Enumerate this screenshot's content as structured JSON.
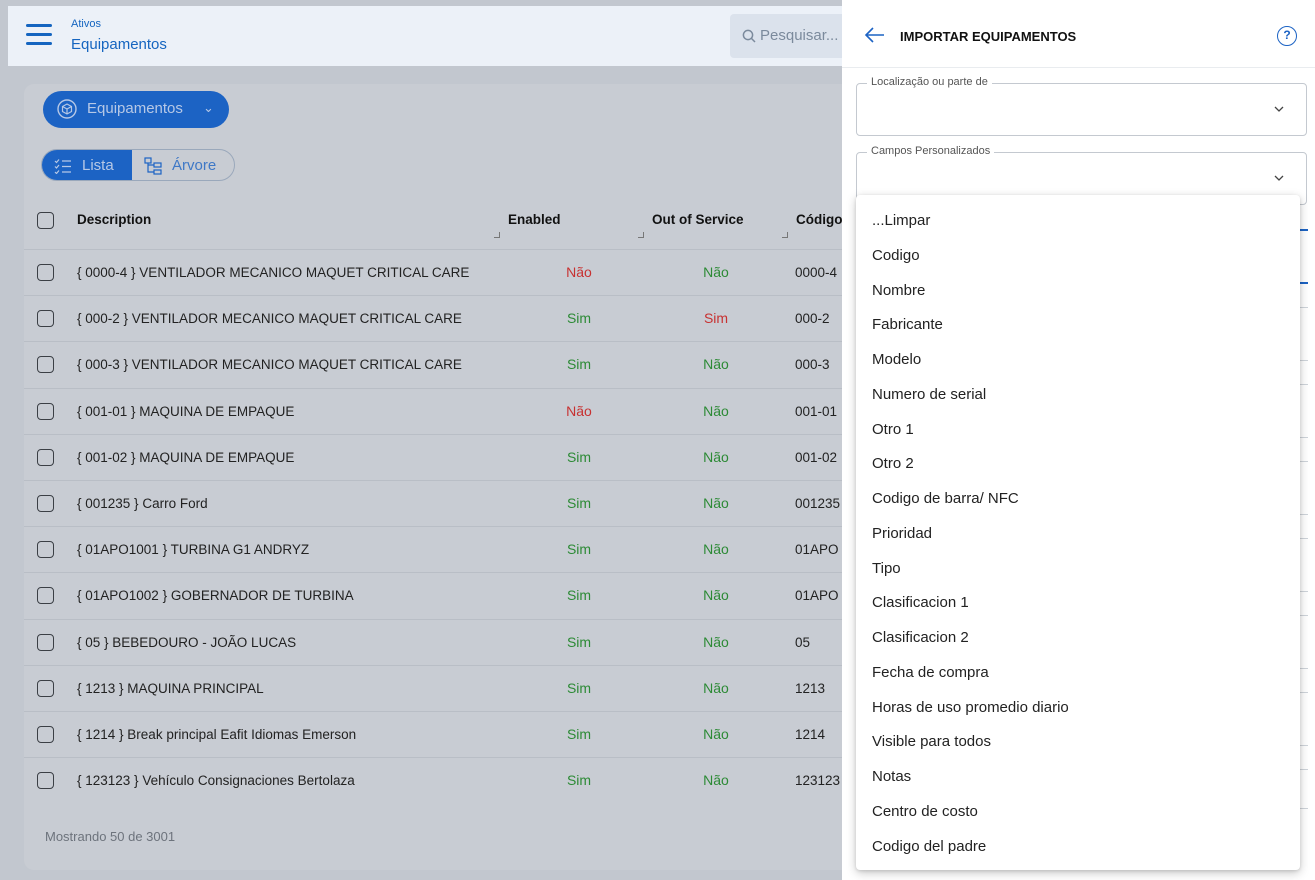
{
  "header": {
    "breadcrumb_parent": "Ativos",
    "title": "Equipamentos",
    "search_placeholder": "Pesquisar..."
  },
  "toolbar": {
    "equipment_selector": "Equipamentos",
    "view_list": "Lista",
    "view_tree": "Árvore"
  },
  "table": {
    "columns": [
      "Description",
      "Enabled",
      "Out of Service",
      "Código"
    ],
    "rows": [
      {
        "description": "{ 0000-4 } VENTILADOR MECANICO MAQUET CRITICAL CARE",
        "enabled": "Não",
        "out_of_service": "Não",
        "code": "0000-4"
      },
      {
        "description": "{ 000-2 } VENTILADOR MECANICO MAQUET CRITICAL CARE",
        "enabled": "Sim",
        "out_of_service": "Sim",
        "code": "000-2"
      },
      {
        "description": "{ 000-3 } VENTILADOR MECANICO MAQUET CRITICAL CARE",
        "enabled": "Sim",
        "out_of_service": "Não",
        "code": "000-3"
      },
      {
        "description": "{ 001-01 } MAQUINA DE EMPAQUE",
        "enabled": "Não",
        "out_of_service": "Não",
        "code": "001-01"
      },
      {
        "description": "{ 001-02 } MAQUINA DE EMPAQUE",
        "enabled": "Sim",
        "out_of_service": "Não",
        "code": "001-02"
      },
      {
        "description": "{ 001235 } Carro Ford",
        "enabled": "Sim",
        "out_of_service": "Não",
        "code": "001235"
      },
      {
        "description": "{ 01APO1001 } TURBINA G1 ANDRYZ",
        "enabled": "Sim",
        "out_of_service": "Não",
        "code": "01APO"
      },
      {
        "description": "{ 01APO1002 } GOBERNADOR DE TURBINA",
        "enabled": "Sim",
        "out_of_service": "Não",
        "code": "01APO"
      },
      {
        "description": "{ 05 } BEBEDOURO - JOÃO LUCAS",
        "enabled": "Sim",
        "out_of_service": "Não",
        "code": "05"
      },
      {
        "description": "{ 1213 } MAQUINA PRINCIPAL",
        "enabled": "Sim",
        "out_of_service": "Não",
        "code": "1213"
      },
      {
        "description": "{ 1214 } Break principal Eafit Idiomas Emerson",
        "enabled": "Sim",
        "out_of_service": "Não",
        "code": "1214"
      },
      {
        "description": "{ 123123 } Vehículo Consignaciones Bertolaza",
        "enabled": "Sim",
        "out_of_service": "Não",
        "code": "123123"
      }
    ],
    "footer": "Mostrando 50 de 3001"
  },
  "panel": {
    "title": "IMPORTAR EQUIPAMENTOS",
    "help_symbol": "?",
    "fields": [
      {
        "label": "Localização ou parte de",
        "value": ""
      },
      {
        "label": "Campos Personalizados",
        "value": ""
      }
    ],
    "dropdown_options": [
      "...Limpar",
      "Codigo",
      "Nombre",
      "Fabricante",
      "Modelo",
      "Numero de serial",
      "Otro 1",
      "Otro 2",
      "Codigo de barra/ NFC",
      "Prioridad",
      "Tipo",
      "Clasificacion 1",
      "Clasificacion 2",
      "Fecha de compra",
      "Horas de uso promedio diario",
      "Visible para todos",
      "Notas",
      "Centro de costo",
      "Codigo del padre"
    ]
  },
  "colors": {
    "accent": "#1c63c4",
    "yes": "#2c8a35",
    "no_enabled": "#c73131",
    "overlay_bg": "#c2c7cf"
  },
  "icons": [
    "menu-icon",
    "search-icon",
    "box-icon",
    "chevron-down-icon",
    "list-icon",
    "tree-icon",
    "back-arrow-icon",
    "help-icon"
  ]
}
